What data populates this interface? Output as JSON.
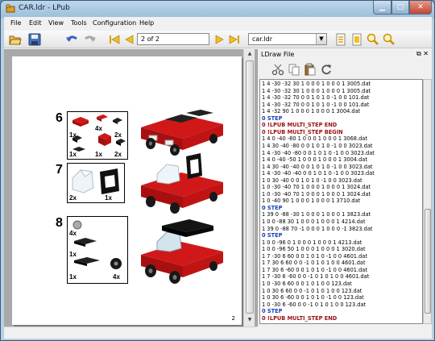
{
  "window": {
    "title": "CAR.ldr - LPub"
  },
  "menu": [
    "File",
    "Edit",
    "View",
    "Tools",
    "Configuration",
    "Help"
  ],
  "toolbar": {
    "page_field": "2 of 2",
    "model_combo": "car.ldr",
    "combo_arrow": "▼",
    "icons": [
      "open-icon",
      "save-icon",
      "undo-icon",
      "redo-icon",
      "first-page-icon",
      "prev-page-icon",
      "next-page-icon",
      "last-page-icon",
      "fit-width-icon",
      "fit-page-icon",
      "zoom-in-icon",
      "zoom-out-icon"
    ]
  },
  "instructions": {
    "steps": [
      {
        "number": "6",
        "parts": [
          {
            "qty": "4x"
          },
          {
            "qty": "1x"
          },
          {
            "qty": "2x"
          },
          {
            "qty": "1x"
          },
          {
            "qty": "1x"
          },
          {
            "qty": "2x"
          }
        ]
      },
      {
        "number": "7",
        "parts": [
          {
            "qty": "2x"
          },
          {
            "qty": "1x"
          }
        ]
      },
      {
        "number": "8",
        "parts": [
          {
            "qty": "4x"
          },
          {
            "qty": "1x"
          },
          {
            "qty": "1x"
          },
          {
            "qty": "4x"
          }
        ]
      }
    ],
    "page_number": "2"
  },
  "dock": {
    "title": "LDraw File",
    "buttons": "⧉ ✕",
    "icons": [
      "cut-icon",
      "copy-icon",
      "paste-icon",
      "redo-icon"
    ]
  },
  "ldraw_lines": [
    {
      "t": "1 4 -30 -32 30 1 0 0 0 1 0 0 0 1 3005.dat",
      "k": "normal"
    },
    {
      "t": "1 4 -30 -32 30 1 0 0 0 1 0 0 0 1 3005.dat",
      "k": "normal"
    },
    {
      "t": "1 4 -30 -32 70 0 0 1 0 1 0 -1 0 0 101.dat",
      "k": "normal"
    },
    {
      "t": "1 4 -30 -32 70 0 0 1 0 1 0 -1 0 0 101.dat",
      "k": "normal"
    },
    {
      "t": "1 4 -32 90 1 0 0 0 1 0 0 0 1 3004.dat",
      "k": "normal"
    },
    {
      "t": "0 STEP",
      "k": "step"
    },
    {
      "t": "0 !LPUB MULTI_STEP END",
      "k": "meta"
    },
    {
      "t": "0 !LPUB MULTI_STEP BEGIN",
      "k": "meta"
    },
    {
      "t": "1 4 0 -40 -80 1 0 0 0 1 0 0 0 1 3068.dat",
      "k": "normal"
    },
    {
      "t": "1 4 30 -40 -80 0 0 1 0 1 0 -1 0 0 3023.dat",
      "k": "normal"
    },
    {
      "t": "1 4 -30 -40 -80 0 0 1 0 1 0 -1 0 0 3023.dat",
      "k": "normal"
    },
    {
      "t": "1 4 0 -40 -50 1 0 0 0 1 0 0 0 1 3004.dat",
      "k": "normal"
    },
    {
      "t": "1 4 30 -40 -40 0 0 1 0 1 0 -1 0 0 3023.dat",
      "k": "normal"
    },
    {
      "t": "1 4 -30 -40 -40 0 0 1 0 1 0 -1 0 0 3023.dat",
      "k": "normal"
    },
    {
      "t": "1 0 30 -40 0 0 1 0 1 0 -1 0 0 3023.dat",
      "k": "normal"
    },
    {
      "t": "1 0 -30 -40 70 1 0 0 0 1 0 0 0 1 3024.dat",
      "k": "normal"
    },
    {
      "t": "1 0 -30 -40 70 1 0 0 0 1 0 0 0 1 3024.dat",
      "k": "normal"
    },
    {
      "t": "1 0 -40 90 1 0 0 0 1 0 0 0 1 3710.dat",
      "k": "normal"
    },
    {
      "t": "0 STEP",
      "k": "step"
    },
    {
      "t": "1 39 0 -88 -30 1 0 0 0 1 0 0 0 1 3823.dat",
      "k": "normal"
    },
    {
      "t": "1 0 0 -88 30 1 0 0 0 1 0 0 0 1 4214.dat",
      "k": "normal"
    },
    {
      "t": "1 39 0 -88 70 -1 0 0 0 1 0 0 0 -1 3823.dat",
      "k": "normal"
    },
    {
      "t": "0 STEP",
      "k": "step"
    },
    {
      "t": "1 0 0 -96 0 1 0 0 0 1 0 0 0 1 4213.dat",
      "k": "normal"
    },
    {
      "t": "1 0 0 -96 50 1 0 0 0 1 0 0 0 1 3020.dat",
      "k": "normal"
    },
    {
      "t": "1 7 -30 6 60 0 0 1 0 1 0 -1 0 0 4601.dat",
      "k": "normal"
    },
    {
      "t": "1 7 30 6 60 0 0 -1 0 1 0 1 0 0 4601.dat",
      "k": "normal"
    },
    {
      "t": "1 7 30 6 -60 0 0 1 0 1 0 -1 0 0 4601.dat",
      "k": "normal"
    },
    {
      "t": "1 7 -30 6 -60 0 0 -1 0 1 0 1 0 0 4601.dat",
      "k": "normal"
    },
    {
      "t": "1 0 -30 6 60 0 0 1 0 1 0 0 123.dat",
      "k": "normal"
    },
    {
      "t": "1 0 30 6 60 0 0 -1 0 1 0 1 0 0 123.dat",
      "k": "normal"
    },
    {
      "t": "1 0 30 6 -60 0 0 1 0 1 0 -1 0 0 123.dat",
      "k": "normal"
    },
    {
      "t": "1 0 -30 6 -60 0 0 -1 0 1 0 1 0 0 123.dat",
      "k": "normal"
    },
    {
      "t": "0 STEP",
      "k": "step"
    },
    {
      "t": "0 !LPUB MULTI_STEP END",
      "k": "meta"
    }
  ],
  "colors": {
    "brick_red": "#d01818",
    "brick_black": "#141414",
    "window_frame": "#b8d0e4",
    "step_blue": "#1a3fb0",
    "meta_red": "#9a1010"
  }
}
